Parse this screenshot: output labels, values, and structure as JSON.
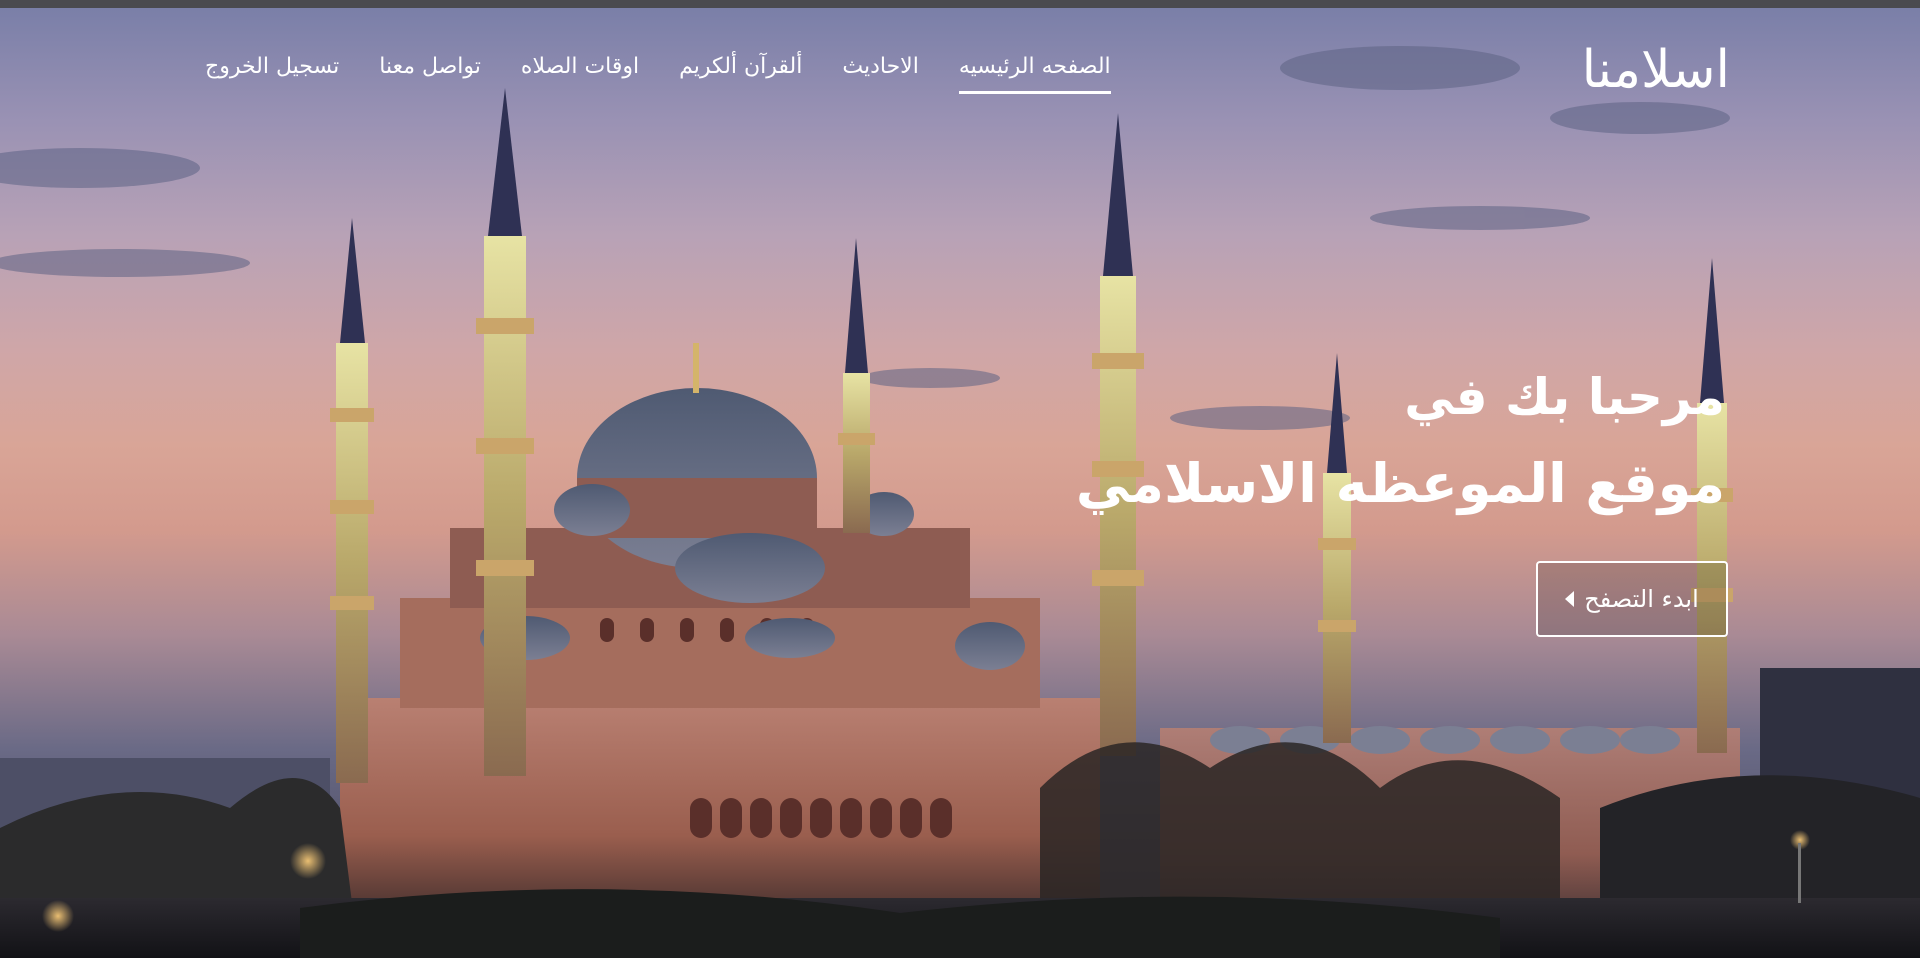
{
  "nav": {
    "logo": "اسلامنا",
    "links": [
      {
        "label": "الصفحه الرئيسيه",
        "active": true
      },
      {
        "label": "الاحاديث",
        "active": false
      },
      {
        "label": "ألقرآن ألكريم",
        "active": false
      },
      {
        "label": "اوقات الصلاه",
        "active": false
      },
      {
        "label": "تواصل معنا",
        "active": false
      },
      {
        "label": "تسجيل الخروج",
        "active": false
      }
    ]
  },
  "hero": {
    "title_line1": "مرحبا بك في",
    "title_line2": "موقع الموعظه الاسلامي",
    "browse_button": "ابدء التصفح",
    "browse_icon": "caret-left-icon",
    "background": "blue-mosque-sunset-photo"
  },
  "colors": {
    "text": "#ffffff",
    "sky_top": "#7a7fa8",
    "sky_mid": "#d9a597",
    "building_lit": "#c9826a",
    "minaret_light": "#d8d090"
  }
}
